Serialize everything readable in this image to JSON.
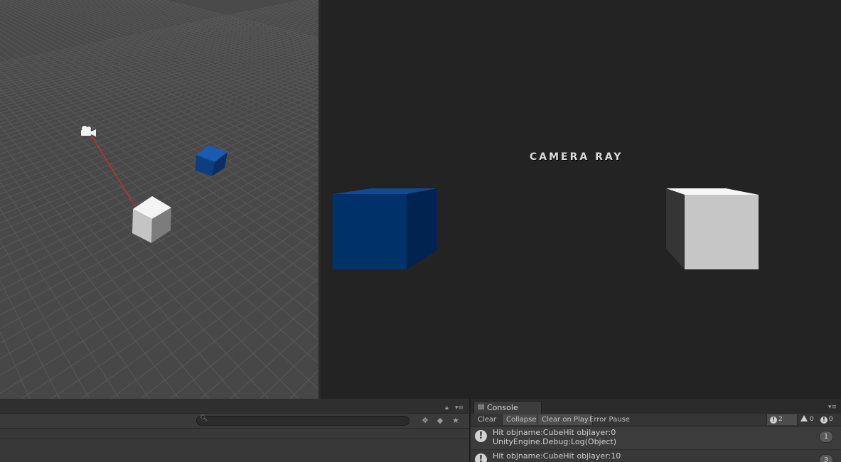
{
  "game_view": {
    "title_text": "CAMERA RAY"
  },
  "scene_view": {
    "icons": [
      "camera-gizmo-icon"
    ],
    "ray_color": "#c0302a",
    "blue_cube_color": "#0e4a8f",
    "white_cube_color": "#e6e6e6"
  },
  "hierarchy": {
    "search": {
      "value": "",
      "placeholder": ""
    },
    "icons": [
      "search-icon",
      "lock-icon",
      "menu-icon",
      "layers-icon",
      "tag-icon",
      "star-icon"
    ]
  },
  "console": {
    "tab_label": "Console",
    "toolbar": {
      "clear": "Clear",
      "collapse": "Collapse",
      "clear_on_play": "Clear on Play",
      "error_pause": "Error Pause"
    },
    "counts": {
      "logs": "2",
      "warnings": "0",
      "errors": "0"
    },
    "entries": [
      {
        "line1": "Hit objname:CubeHit objlayer:0",
        "line2": "UnityEngine.Debug:Log(Object)",
        "count": "1"
      },
      {
        "line1": "Hit objname:CubeHit objlayer:10",
        "line2": "",
        "count": "3"
      }
    ]
  }
}
